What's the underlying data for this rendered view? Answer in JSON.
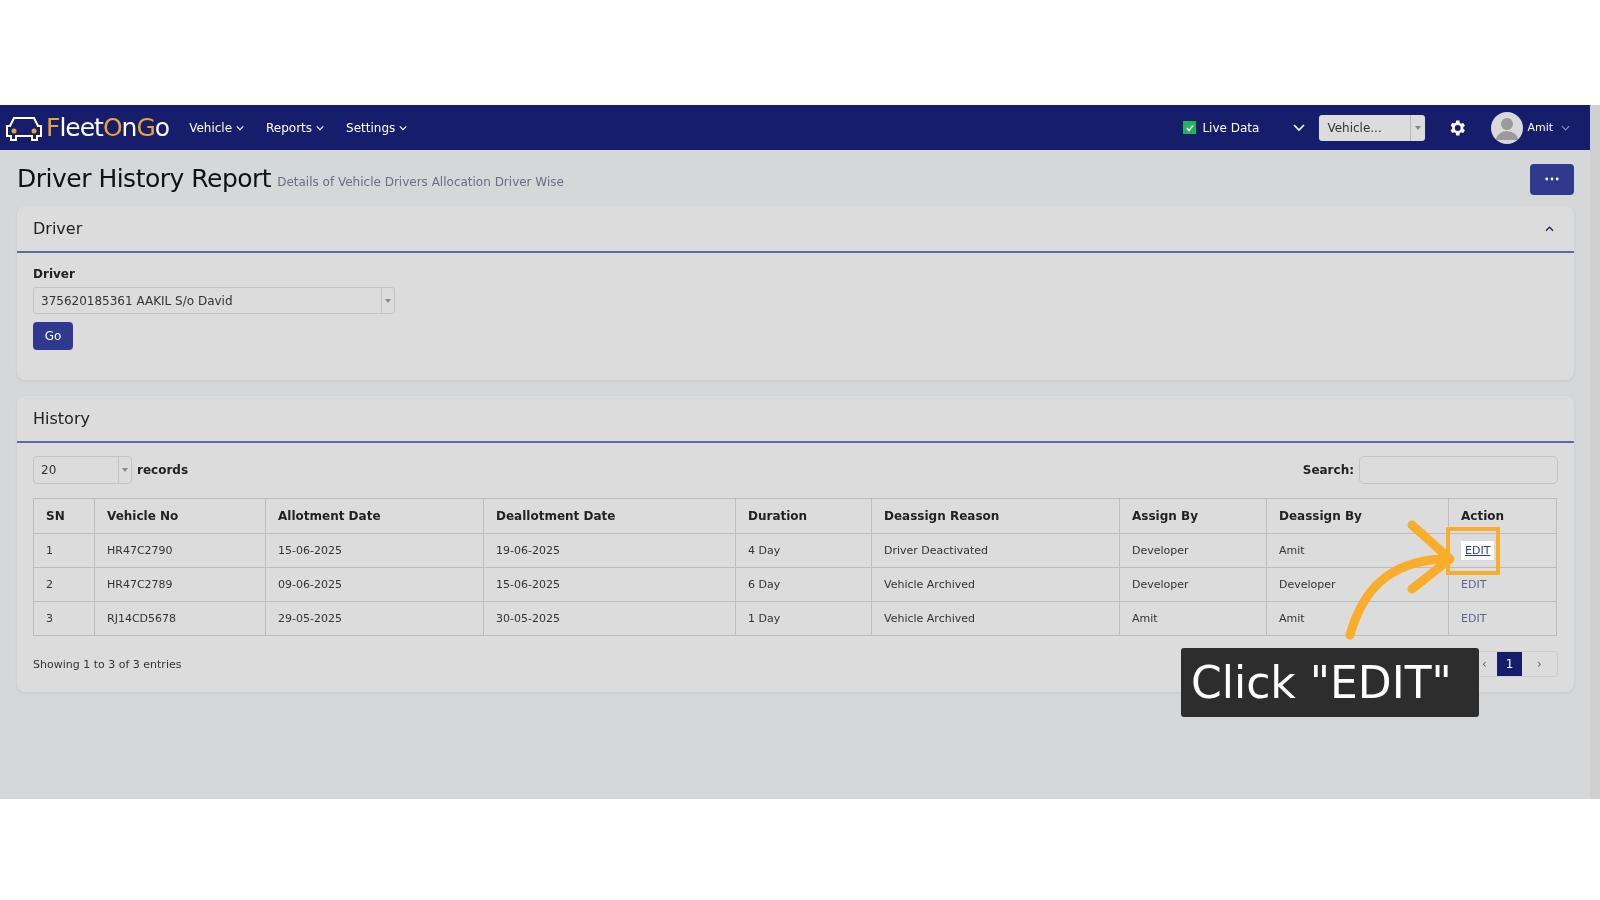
{
  "navbar": {
    "logo": [
      {
        "text": "F",
        "accent": true
      },
      {
        "text": "leet",
        "accent": false
      },
      {
        "text": "O",
        "accent": true
      },
      {
        "text": "n",
        "accent": false
      },
      {
        "text": "G",
        "accent": true
      },
      {
        "text": "o",
        "accent": false
      }
    ],
    "menu": [
      "Vehicle",
      "Reports",
      "Settings"
    ],
    "live_data": {
      "label": "Live Data",
      "checked": true
    },
    "vehicle_select": {
      "placeholder": "Vehicle..."
    },
    "user": "Amit"
  },
  "page": {
    "title": "Driver History Report",
    "subtitle": "Details of Vehicle Drivers Allocation Driver Wise"
  },
  "driver_card": {
    "title": "Driver",
    "expanded": true,
    "field_label": "Driver",
    "value": "375620185361 AAKIL S/o David",
    "button": "Go"
  },
  "history_card": {
    "title": "History",
    "page_size": "20",
    "page_size_label": "records",
    "search_label": "Search:",
    "table": {
      "columns": [
        "SN",
        "Vehicle No",
        "Allotment Date",
        "Deallotment Date",
        "Duration",
        "Deassign Reason",
        "Assign By",
        "Deassign By",
        "Action"
      ],
      "rows": [
        {
          "cells": [
            "1",
            "HR47C2790",
            "15-06-2025",
            "19-06-2025",
            "4 Day",
            "Driver Deactivated",
            "Developer",
            "Amit"
          ],
          "action": "EDIT",
          "highlighted": true
        },
        {
          "cells": [
            "2",
            "HR47C2789",
            "09-06-2025",
            "15-06-2025",
            "6 Day",
            "Vehicle Archived",
            "Developer",
            "Developer"
          ],
          "action": "EDIT",
          "highlighted": false
        },
        {
          "cells": [
            "3",
            "RJ14CD5678",
            "29-05-2025",
            "30-05-2025",
            "1 Day",
            "Vehicle Archived",
            "Amit",
            "Amit"
          ],
          "action": "EDIT",
          "highlighted": false
        }
      ]
    },
    "info": "Showing 1 to 3 of 3 entries",
    "pagination": {
      "prev": "‹",
      "pages": [
        {
          "label": "1",
          "selected": true
        }
      ],
      "next": "›"
    }
  },
  "callout": {
    "text": "Click \"EDIT\""
  }
}
